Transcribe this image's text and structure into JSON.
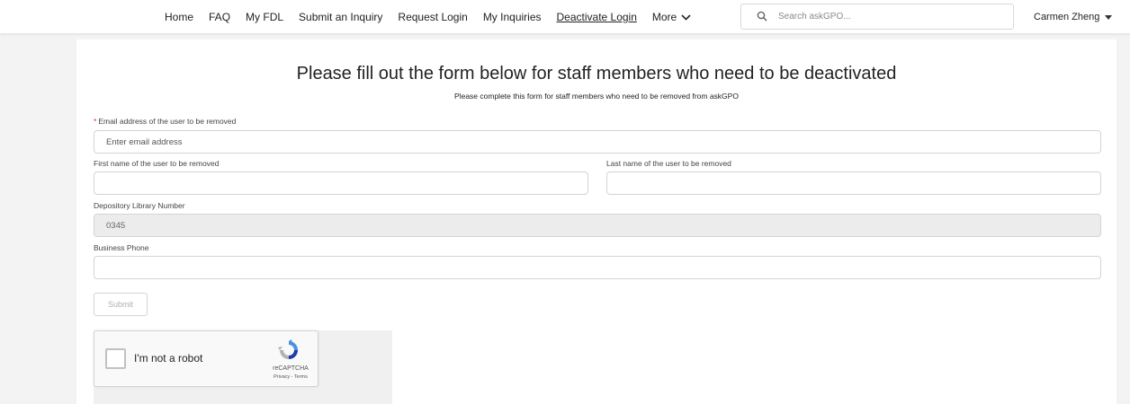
{
  "nav": {
    "items": [
      "Home",
      "FAQ",
      "My FDL",
      "Submit an Inquiry",
      "Request Login",
      "My Inquiries",
      "Deactivate Login"
    ],
    "more_label": "More"
  },
  "search": {
    "placeholder": "Search askGPO..."
  },
  "user": {
    "name": "Carmen Zheng"
  },
  "form": {
    "title": "Please fill out the form below for staff members who need to be deactivated",
    "subtitle": "Please complete this form for staff members who need to be removed from askGPO",
    "email_required_mark": "*",
    "email_label": "Email address of the user to be removed",
    "email_placeholder": "Enter email address",
    "first_name_label": "First name of the user to be removed",
    "first_name_value": "",
    "last_name_label": "Last name of the user to be removed",
    "last_name_value": "",
    "library_number_label": "Depository Library Number",
    "library_number_value": "0345",
    "phone_label": "Business Phone",
    "phone_value": "",
    "submit_label": "Submit"
  },
  "captcha": {
    "label": "I'm not a robot",
    "brand": "reCAPTCHA",
    "links": "Privacy - Terms"
  },
  "colors": {
    "required": "#c23934",
    "captcha_blue": "#4a90e2",
    "disabled_field": "#ececec"
  }
}
